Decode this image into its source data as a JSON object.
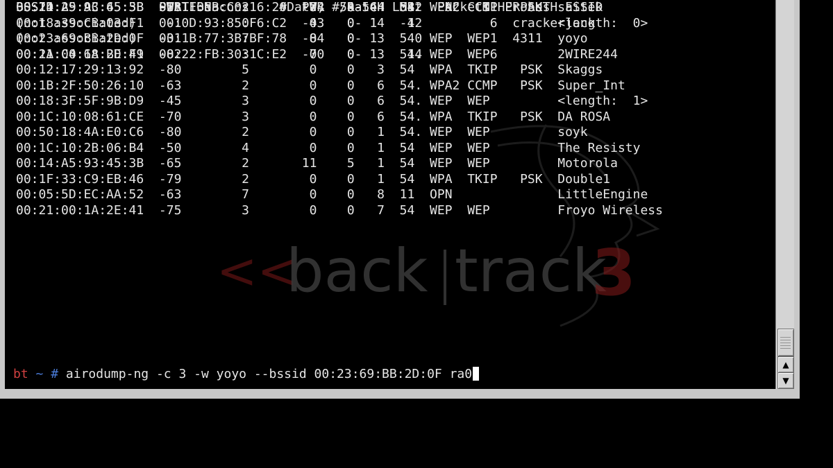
{
  "terminal": {
    "ap_header": "BSSID              PWR  Beacons    #Data, #/s  CH  MB   ENC  CIPHER AUTH ESSID",
    "ap_rows": [
      "00:21:29:AC:65:5B  -58        2        0    0   4  54  WPA2 CCMP   PSK  saitek",
      "00:18:39:CB:03:F1   -1        0        0    0  14  -1                   <length:  0>",
      "00:23:69:BB:2D:0F  -31        7        0    0   3  54  WEP  WEP         yoyo",
      "00:1A:C4:68:BD:F9  -82        3        0    0   3  54. WEP  WEP         2WIRE244",
      "00:12:17:29:13:92  -80        5        0    0   3  54  WPA  TKIP   PSK  Skaggs",
      "00:1B:2F:50:26:10  -63        2        0    0   6  54. WPA2 CCMP   PSK  Super_Int",
      "00:18:3F:5F:9B:D9  -45        3        0    0   6  54. WEP  WEP         <length:  1>",
      "00:1C:10:08:61:CE  -70        3        0    0   6  54. WPA  TKIP   PSK  DA ROSA",
      "00:50:18:4A:E0:C6  -80        2        0    0   1  54. WEP  WEP         soyk",
      "00:1C:10:2B:06:B4  -50        4        0    0   1  54  WEP  WEP         The Resisty",
      "00:14:A5:93:45:3B  -65        2       11    5   1  54  WEP  WEP         Motorola",
      "00:1F:33:C9:EB:46  -79        2        0    0   1  54  WPA  TKIP   PSK  Double1",
      "00:05:5D:EC:AA:52  -63        7        0    0   8  11  OPN              LittleEngine",
      "00:21:00:1A:2E:41  -75        3        0    0   7  54  WEP  WEP         Froyo Wireless"
    ],
    "station_header": "BSSID              STATION            PWR   Rate  Lost  Packets  Probes",
    "station_rows": [
      "00:14:A5:93:45:3B  00:1F:5B:C0:16:20  -74  54-54    12        11",
      "(not associated)   00:0D:93:85:F6:C2  -43   0- 1    42         6  crackerjack",
      "(not associated)   00:1B:77:3B:BF:78  -84   0- 1     0         1  4311",
      "00:21:00:1A:2E:41  00:22:FB:30:1C:E2  -70   0- 1    14         6"
    ],
    "prompt_user": "bt",
    "prompt_path": "~",
    "prompt_symbol": "#",
    "command": "airodump-ng -c 3 -w yoyo --bssid 00:23:69:BB:2D:0F ra0"
  },
  "wallpaper": {
    "logo_text": "<< back | track 3",
    "accent_color": "#7a1818"
  },
  "scrollbar": {
    "up_icon": "▲",
    "down_icon": "▼"
  },
  "colors": {
    "background": "#000000",
    "text": "#e6e6e6",
    "prompt_user": "#d04040",
    "prompt_path": "#4a7bd8"
  }
}
